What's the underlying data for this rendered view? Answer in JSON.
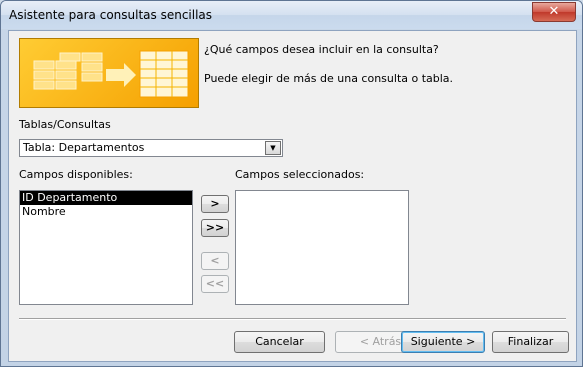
{
  "window": {
    "title": "Asistente para consultas sencillas",
    "close_glyph": "✕"
  },
  "intro": {
    "question": "¿Qué campos desea incluir en la consulta?",
    "hint": "Puede elegir de más de una consulta o tabla."
  },
  "source": {
    "label": "Tablas/Consultas",
    "value": "Tabla: Departamentos",
    "arrow": "▼"
  },
  "available": {
    "label": "Campos disponibles:",
    "items": [
      "ID Departamento",
      "Nombre"
    ]
  },
  "selected": {
    "label": "Campos seleccionados:"
  },
  "move_buttons": {
    "add": ">",
    "add_all": ">>",
    "remove": "<",
    "remove_all": "<<"
  },
  "footer": {
    "cancel": "Cancelar",
    "back": "< Atrás",
    "next": "Siguiente >",
    "finish": "Finalizar"
  },
  "colors": {
    "illustration_orange": "#f5a000",
    "selection": "#000000"
  }
}
